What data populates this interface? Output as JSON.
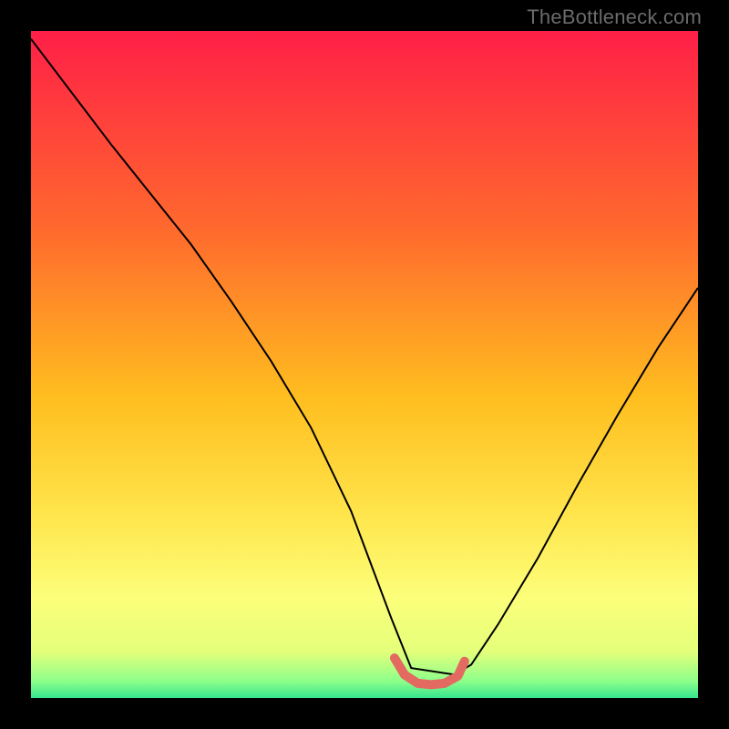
{
  "watermark": "TheBottleneck.com",
  "chart_data": {
    "type": "line",
    "title": "",
    "xlabel": "",
    "ylabel": "",
    "xlim": [
      0,
      1
    ],
    "ylim": [
      0,
      1
    ],
    "grid": false,
    "background_gradient_stops": [
      {
        "offset": 0.0,
        "color": "#ff1f47"
      },
      {
        "offset": 0.3,
        "color": "#ff6a2d"
      },
      {
        "offset": 0.55,
        "color": "#ffbe1f"
      },
      {
        "offset": 0.72,
        "color": "#ffe44a"
      },
      {
        "offset": 0.85,
        "color": "#fcff7a"
      },
      {
        "offset": 0.93,
        "color": "#e4ff7a"
      },
      {
        "offset": 0.975,
        "color": "#8dff8b"
      },
      {
        "offset": 1.0,
        "color": "#35e58f"
      }
    ],
    "series": [
      {
        "name": "notch-curve",
        "stroke": "#000000",
        "stroke_width": 2,
        "x": [
          0.0,
          0.06,
          0.12,
          0.18,
          0.24,
          0.3,
          0.36,
          0.42,
          0.48,
          0.51,
          0.54,
          0.57,
          0.635,
          0.66,
          0.7,
          0.76,
          0.82,
          0.88,
          0.94,
          1.0
        ],
        "values": [
          0.988,
          0.909,
          0.83,
          0.755,
          0.68,
          0.595,
          0.505,
          0.405,
          0.28,
          0.2,
          0.12,
          0.045,
          0.035,
          0.05,
          0.11,
          0.21,
          0.32,
          0.425,
          0.525,
          0.615
        ]
      },
      {
        "name": "floor-marker",
        "stroke": "#e36a61",
        "stroke_width": 10,
        "stroke_linecap": "round",
        "x": [
          0.545,
          0.56,
          0.58,
          0.6,
          0.62,
          0.64,
          0.65
        ],
        "values": [
          0.06,
          0.035,
          0.022,
          0.02,
          0.022,
          0.033,
          0.055
        ]
      }
    ]
  }
}
